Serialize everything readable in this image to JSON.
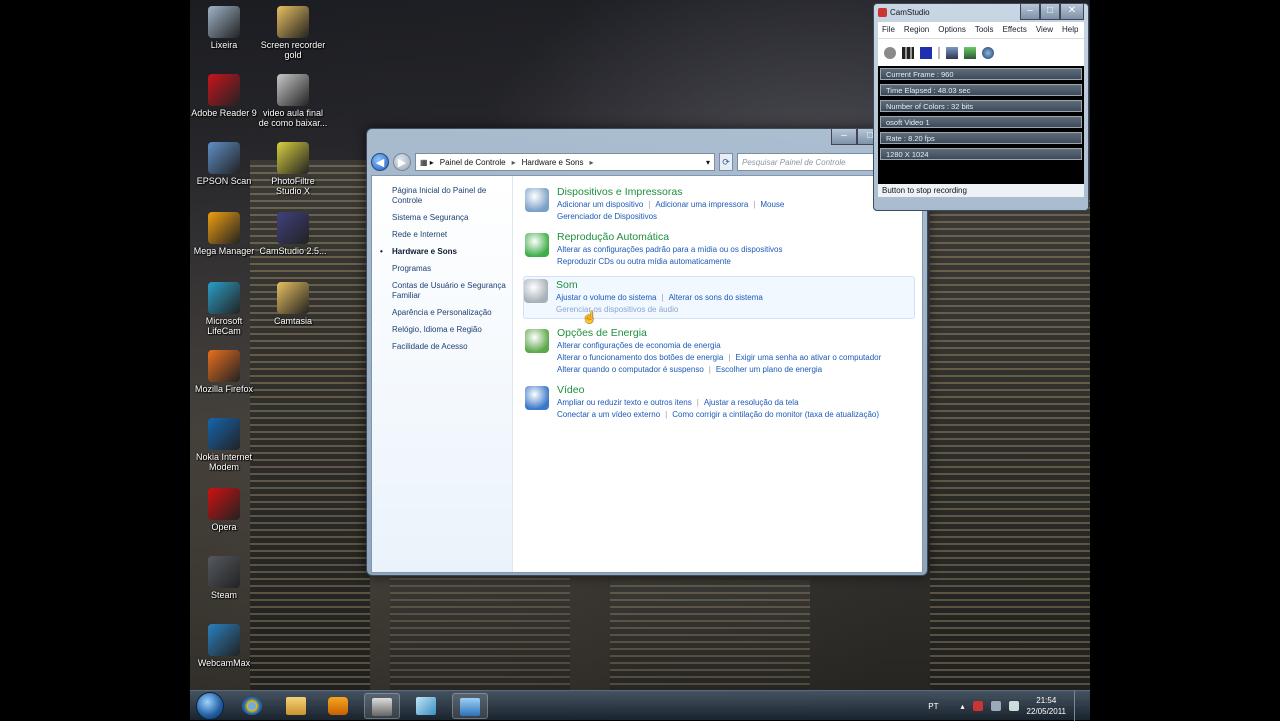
{
  "desktop_icons": [
    {
      "label": "Lixeira",
      "icon": "recycle-bin-icon",
      "color": "#9fb4c8"
    },
    {
      "label": "Screen recorder gold",
      "icon": "folder-icon",
      "color": "#e8c060"
    },
    {
      "label": "Adobe Reader 9",
      "icon": "adobe-reader-icon",
      "color": "#c8141e"
    },
    {
      "label": "video aula final de como baixar...",
      "icon": "video-file-icon",
      "color": "#c8c8c8"
    },
    {
      "label": "EPSON Scan",
      "icon": "scanner-icon",
      "color": "#5f8fc8"
    },
    {
      "label": "PhotoFiltre Studio X",
      "icon": "photofiltre-icon",
      "color": "#d8d040"
    },
    {
      "label": "Mega Manager",
      "icon": "mega-manager-icon",
      "color": "#f0a010"
    },
    {
      "label": "CamStudio 2.5...",
      "icon": "camstudio-icon",
      "color": "#404080"
    },
    {
      "label": "Microsoft LifeCam",
      "icon": "lifecam-icon",
      "color": "#2aa0c8"
    },
    {
      "label": "Camtasia",
      "icon": "folder-icon",
      "color": "#e8c060"
    },
    {
      "label": "Mozilla Firefox",
      "icon": "firefox-icon",
      "color": "#e87020"
    },
    {
      "label": "Nokia Internet Modem",
      "icon": "vivo-icon",
      "color": "#1565b0"
    },
    {
      "label": "Opera",
      "icon": "opera-icon",
      "color": "#d01010"
    },
    {
      "label": "Steam",
      "icon": "steam-icon",
      "color": "#555a60"
    },
    {
      "label": "WebcamMax",
      "icon": "webcammax-icon",
      "color": "#2a80c0"
    }
  ],
  "camstudio": {
    "title": "CamStudio",
    "menu": [
      "File",
      "Region",
      "Options",
      "Tools",
      "Effects",
      "View",
      "Help"
    ],
    "stats": [
      "Current Frame : 960",
      "Time Elapsed : 48.03 sec",
      "Number of Colors : 32 bits",
      "osoft Video 1",
      "Rate : 8.20 fps",
      "1280 X 1024"
    ],
    "status": "Button to stop recording"
  },
  "control_panel": {
    "breadcrumb": [
      "Painel de Controle",
      "Hardware e Sons"
    ],
    "search_placeholder": "Pesquisar Painel de Controle",
    "sidebar": [
      "Página Inicial do Painel de Controle",
      "Sistema e Segurança",
      "Rede e Internet",
      "Hardware e Sons",
      "Programas",
      "Contas de Usuário e Segurança Familiar",
      "Aparência e Personalização",
      "Relógio, Idioma e Região",
      "Facilidade de Acesso"
    ],
    "active_index": 3,
    "categories": [
      {
        "title": "Dispositivos e Impressoras",
        "icon": "devices-printers-icon",
        "lines": [
          [
            "Adicionar um dispositivo",
            "Adicionar uma impressora",
            "Mouse"
          ],
          [
            "Gerenciador de Dispositivos"
          ]
        ]
      },
      {
        "title": "Reprodução Automática",
        "icon": "autoplay-icon",
        "lines": [
          [
            "Alterar as configurações padrão para a mídia ou os dispositivos"
          ],
          [
            "Reproduzir CDs ou outra mídia automaticamente"
          ]
        ]
      },
      {
        "title": "Som",
        "icon": "sound-icon",
        "lines": [
          [
            "Ajustar o volume do sistema",
            "Alterar os sons do sistema"
          ],
          [
            "Gerenciar os dispositivos de áudio"
          ]
        ]
      },
      {
        "title": "Opções de Energia",
        "icon": "power-options-icon",
        "lines": [
          [
            "Alterar configurações de economia de energia"
          ],
          [
            "Alterar o funcionamento dos botões de energia",
            "Exigir uma senha ao ativar o computador"
          ],
          [
            "Alterar quando o computador é suspenso",
            "Escolher um plano de energia"
          ]
        ]
      },
      {
        "title": "Vídeo",
        "icon": "display-icon",
        "lines": [
          [
            "Ampliar ou reduzir texto e outros itens",
            "Ajustar a resolução da tela"
          ],
          [
            "Conectar a um vídeo externo",
            "Como corrigir a cintilação do monitor (taxa de atualização)"
          ]
        ]
      }
    ]
  },
  "taskbar": {
    "language": "PT",
    "time": "21:54",
    "date": "22/05/2011"
  }
}
